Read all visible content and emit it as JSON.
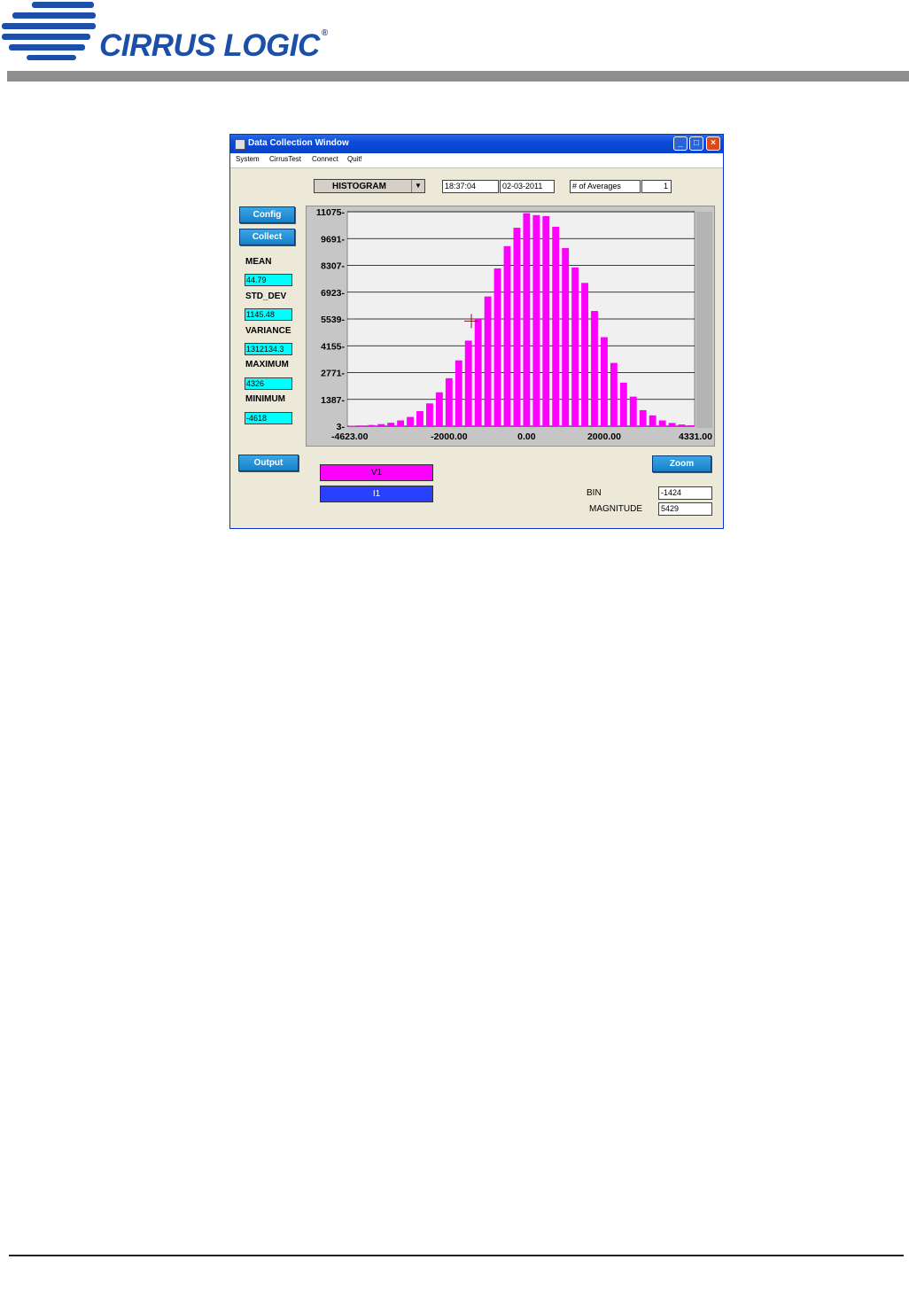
{
  "brand": {
    "name": "CIRRUS LOGIC",
    "reg": "®",
    "color": "#1b4fa8"
  },
  "window": {
    "title": "Data Collection Window",
    "controls": [
      "minimize-icon",
      "maximize-icon",
      "close-icon"
    ],
    "menu": [
      "System",
      "CirrusTest",
      "Connect",
      "Quit!"
    ]
  },
  "toolbar": {
    "mode": "HISTOGRAM",
    "time": "18:37:04",
    "date": "02-03-2011",
    "averages_label": "# of Averages",
    "averages_value": "1"
  },
  "buttons": {
    "config": "Config",
    "collect": "Collect",
    "output": "Output",
    "zoom": "Zoom"
  },
  "stats": {
    "mean_label": "MEAN",
    "mean": "44.79",
    "std_label": "STD_DEV",
    "std": "1145.48",
    "var_label": "VARIANCE",
    "var": "1312134.3",
    "max_label": "MAXIMUM",
    "max": "4326",
    "min_label": "MINIMUM",
    "min": "-4618"
  },
  "channels": {
    "v1": "V1",
    "i1": "I1"
  },
  "readout": {
    "bin_label": "BIN",
    "bin": "-1424",
    "mag_label": "MAGNITUDE",
    "mag": "5429"
  },
  "colors": {
    "bars": "#ff00ff",
    "plot_bg": "#f0f0f0",
    "button": "#1f8fd6",
    "stat_field": "#00ffff"
  },
  "chart_data": {
    "type": "bar",
    "title": "",
    "xlabel": "",
    "ylabel": "",
    "xlim": [
      -4623,
      4331
    ],
    "ylim": [
      3,
      11075
    ],
    "yticks": [
      "11075",
      "9691",
      "8307",
      "6923",
      "5539",
      "4155",
      "2771",
      "1387",
      "3"
    ],
    "xticks": [
      "-4623.00",
      "-2000.00",
      "0.00",
      "2000.00",
      "4331.00"
    ],
    "grid": true,
    "x": [
      -4500,
      -4250,
      -4000,
      -3750,
      -3500,
      -3250,
      -3000,
      -2750,
      -2500,
      -2250,
      -2000,
      -1750,
      -1500,
      -1250,
      -1000,
      -750,
      -500,
      -250,
      0,
      250,
      500,
      750,
      1000,
      1250,
      1500,
      1750,
      2000,
      2250,
      2500,
      2750,
      3000,
      3250,
      3500,
      3750,
      4000,
      4250
    ],
    "series": [
      {
        "name": "V1",
        "values": [
          25,
          40,
          65,
          110,
          180,
          300,
          480,
          780,
          1180,
          1750,
          2480,
          3400,
          4420,
          5540,
          6700,
          8150,
          9300,
          10250,
          11000,
          10900,
          10850,
          10300,
          9200,
          8200,
          7400,
          5950,
          4600,
          3270,
          2250,
          1530,
          830,
          560,
          300,
          170,
          90,
          50
        ]
      }
    ],
    "cursor": {
      "x": -1424,
      "y": 5429
    }
  }
}
